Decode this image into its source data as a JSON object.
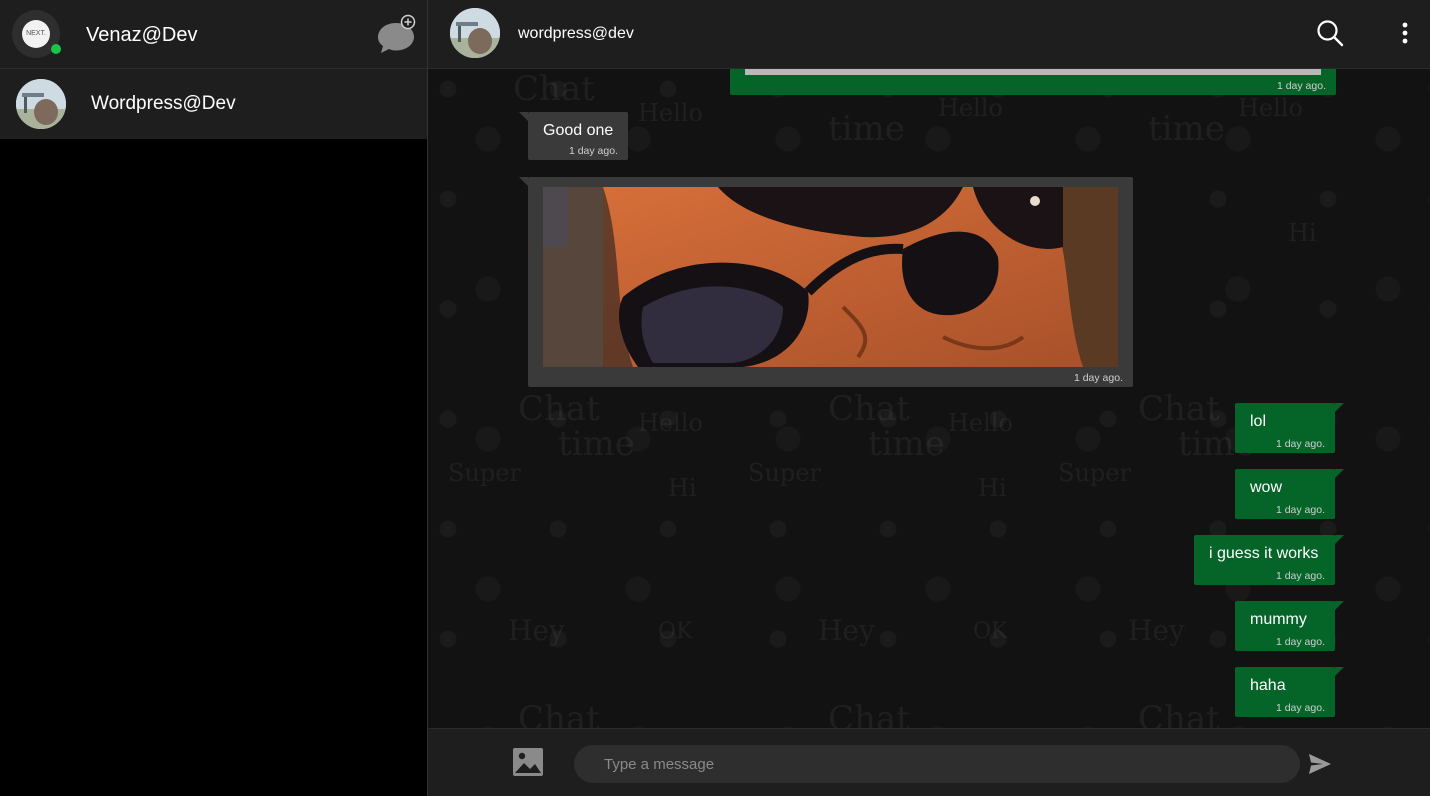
{
  "sidebar": {
    "user_name": "Venaz@Dev",
    "logo_text": "NEXT.",
    "contacts": [
      {
        "name": "Wordpress@Dev"
      }
    ]
  },
  "chat": {
    "title": "wordpress@dev",
    "messages": [
      {
        "direction": "out",
        "type": "image",
        "time": "1 day ago."
      },
      {
        "direction": "in",
        "type": "text",
        "text": "Good one",
        "time": "1 day ago."
      },
      {
        "direction": "in",
        "type": "image",
        "time": "1 day ago."
      },
      {
        "direction": "out",
        "type": "text",
        "text": "lol",
        "time": "1 day ago."
      },
      {
        "direction": "out",
        "type": "text",
        "text": "wow",
        "time": "1 day ago."
      },
      {
        "direction": "out",
        "type": "text",
        "text": "i guess it works",
        "time": "1 day ago."
      },
      {
        "direction": "out",
        "type": "text",
        "text": "mummy",
        "time": "1 day ago."
      },
      {
        "direction": "out",
        "type": "text",
        "text": "haha",
        "time": "1 day ago."
      }
    ]
  },
  "composer": {
    "placeholder": "Type a message"
  },
  "icons": {
    "new_chat": "new-chat-icon",
    "search": "search-icon",
    "menu": "more-vertical-icon",
    "image": "image-icon",
    "send": "send-icon"
  },
  "colors": {
    "outgoing_bubble": "#056529",
    "incoming_bubble": "#3a3a3a",
    "online": "#19c44b",
    "panel": "#1e1e1e"
  }
}
